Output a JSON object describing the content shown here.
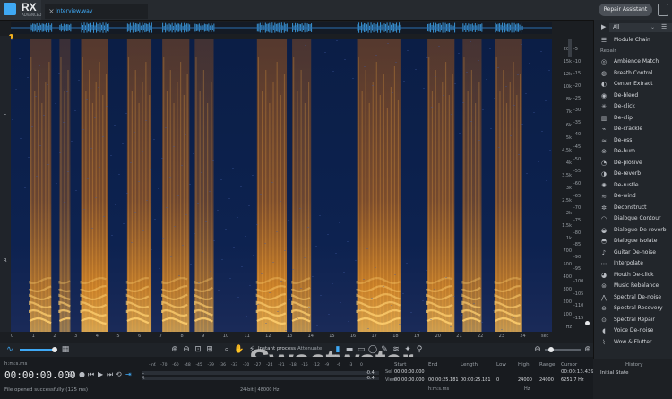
{
  "app": {
    "logo": "RX",
    "logo_sub": "ADVANCED",
    "tab_title": "Interview.wav",
    "repair_assistant": "Repair Assistant"
  },
  "freq_labels": [
    "20k",
    "15k",
    "12k",
    "10k",
    "8k",
    "7k",
    "6k",
    "5k",
    "4.5k",
    "4k",
    "3.5k",
    "3k",
    "2.5k",
    "2k",
    "1.5k",
    "1k",
    "700",
    "500",
    "400",
    "300",
    "200",
    "100",
    "Hz"
  ],
  "db_labels": [
    "-5",
    "-10",
    "-15",
    "-20",
    "-25",
    "-30",
    "-35",
    "-40",
    "-45",
    "-50",
    "-55",
    "-60",
    "-65",
    "-70",
    "-75",
    "-80",
    "-85",
    "-90",
    "-95",
    "-100",
    "-105",
    "-110",
    "-115"
  ],
  "time_labels": [
    "0",
    "1",
    "2",
    "3",
    "4",
    "5",
    "6",
    "7",
    "8",
    "9",
    "10",
    "11",
    "12",
    "13",
    "14",
    "15",
    "16",
    "17",
    "18",
    "19",
    "20",
    "21",
    "22",
    "23",
    "24",
    "sec"
  ],
  "channel_labels": {
    "left": "L",
    "right": "R"
  },
  "toolbar": {
    "instant_process": "Instant process",
    "attenuate": "Attenuate"
  },
  "transport": {
    "format": "h:m:s.ms",
    "timecode": "00:00:00.000",
    "status": "File opened successfully (125 ms)"
  },
  "meter": {
    "scale": [
      "-Inf.",
      "-70",
      "-60",
      "-48",
      "-45",
      "-39",
      "-36",
      "-33",
      "-30",
      "-27",
      "-24",
      "-21",
      "-18",
      "-15",
      "-12",
      "-9",
      "-6",
      "-3",
      "0"
    ],
    "l": "L",
    "r": "R",
    "val_l": "-0.4",
    "val_r": "-0.4",
    "format": "24-bit | 48000 Hz"
  },
  "selection": {
    "headers": [
      "Start",
      "End",
      "Length",
      "Low",
      "High",
      "Range",
      "Cursor"
    ],
    "sel_label": "Sel",
    "view_label": "View",
    "sel": [
      "00:00:00.000",
      "",
      "",
      "",
      "",
      "",
      ""
    ],
    "view": [
      "00:00:00.000",
      "00:00:25.181",
      "00:00:25.181",
      "0",
      "24000",
      "24000",
      "6251.7 Hz"
    ],
    "cursor_time": "00:00:13.439",
    "units_time": "h:m:s.ms",
    "units_hz": "Hz"
  },
  "panel": {
    "filter": "All",
    "module_chain": "Module Chain",
    "repair_header": "Repair",
    "modules": [
      "Ambience Match",
      "Breath Control",
      "Center Extract",
      "De-bleed",
      "De-click",
      "De-clip",
      "De-crackle",
      "De-ess",
      "De-hum",
      "De-plosive",
      "De-reverb",
      "De-rustle",
      "De-wind",
      "Deconstruct",
      "Dialogue Contour",
      "Dialogue De-reverb",
      "Dialogue Isolate",
      "Guitar De-noise",
      "Interpolate",
      "Mouth De-click",
      "Music Rebalance",
      "Spectral De-noise",
      "Spectral Recovery",
      "Spectral Repair",
      "Voice De-noise",
      "Wow & Flutter"
    ],
    "module_icons": [
      "ambience-icon",
      "breath-icon",
      "center-icon",
      "bleed-icon",
      "click-icon",
      "clip-icon",
      "crackle-icon",
      "ess-icon",
      "hum-icon",
      "plosive-icon",
      "reverb-icon",
      "rustle-icon",
      "wind-icon",
      "deconstruct-icon",
      "contour-icon",
      "dialogue-reverb-icon",
      "isolate-icon",
      "guitar-icon",
      "interpolate-icon",
      "mouth-icon",
      "rebalance-icon",
      "spectral-denoise-icon",
      "recovery-icon",
      "spectral-repair-icon",
      "voice-icon",
      "wow-icon"
    ],
    "history": "History",
    "initial_state": "Initial State"
  },
  "watermark": "Sweetwater",
  "colors": {
    "accent": "#3fa9f5",
    "spec_bg": "#0a1d44",
    "spec_hot": "#ff9a1a"
  }
}
